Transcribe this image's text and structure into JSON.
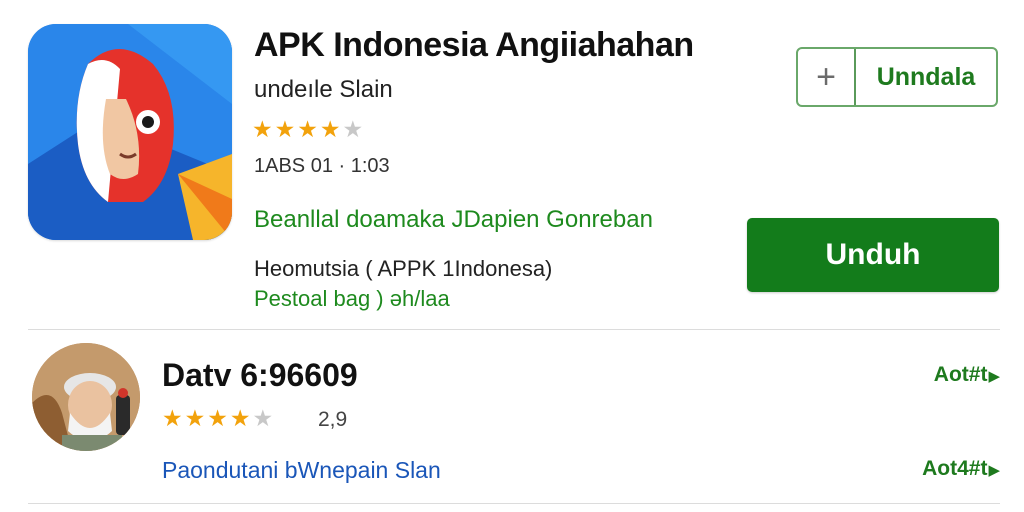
{
  "app": {
    "title": "APK Indonesia Angiiahahan",
    "subtitle": "undeıle Slain",
    "rating_stars": 4,
    "max_stars": 5,
    "meta": "1ABS 01 · 1:03",
    "description": "Beanllal doamaka JDapien Gonreban",
    "developer": "Heomutsia ( APPK 1Indonesa)",
    "tags": "Pestoal bag ) əh/laa",
    "add_icon": "plus-icon",
    "secondary_button_label": "Unndala",
    "primary_button_label": "Unduh",
    "colors": {
      "primary_button": "#137c1b",
      "accent_green": "#1e8a1e",
      "star": "#f2a20c"
    }
  },
  "list": [
    {
      "title": "Datv 6:96609",
      "rating_stars": 4,
      "rating_value": "2,9",
      "description": "Paondutani bWnepain Slan",
      "action_top": "Aot#t",
      "action_bottom": "Aot4#t",
      "action_icon": "chevron-right-icon"
    }
  ]
}
